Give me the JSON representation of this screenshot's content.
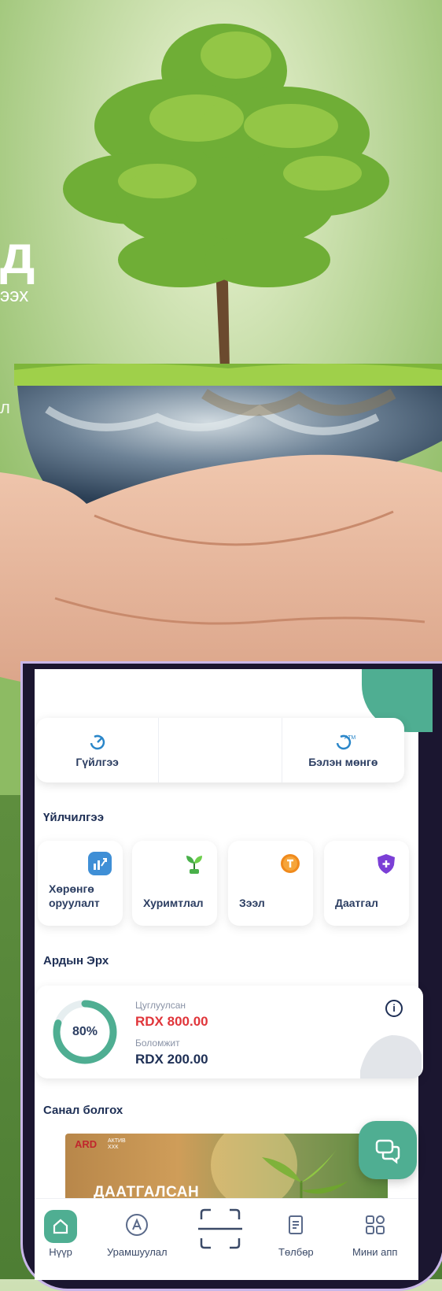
{
  "hero": {
    "title_fragment": "д",
    "subtitle_fragment": "ээх",
    "side_fragment": "л"
  },
  "quick_actions": [
    {
      "label": "Гүйлгээ",
      "icon": "transfer-icon"
    },
    {
      "label": "",
      "icon": ""
    },
    {
      "label": "Бэлэн мөнгө",
      "icon": "atm-icon",
      "icon_text": "ATM"
    }
  ],
  "services": {
    "title": "Үйлчилгээ",
    "items": [
      {
        "label": "Хөрөнгө оруулалт",
        "icon": "investment-chart-icon",
        "color": "#3f8fd6"
      },
      {
        "label": "Хуримтлал",
        "icon": "plant-savings-icon",
        "color": "#49b04a"
      },
      {
        "label": "Зээл",
        "icon": "loan-coin-icon",
        "color": "#f08a1c"
      },
      {
        "label": "Даатгал",
        "icon": "shield-plus-icon",
        "color": "#7b3fd6"
      }
    ]
  },
  "ardyn_erkh": {
    "title": "Ардын Эрх",
    "percent_label": "80%",
    "progress": 0.8,
    "collected_label": "Цуглуулсан",
    "collected_value": "RDX 800.00",
    "available_label": "Боломжит",
    "available_value": "RDX 200.00",
    "accent": "#4fae92",
    "collected_color": "#e0353a"
  },
  "offers": {
    "title": "Санал болгох",
    "banner_logo": "ARD",
    "banner_sub": "АКТИВ\nХХК",
    "banner_text": "ДААТГАЛСАН"
  },
  "bottom_nav": [
    {
      "label": "Нүүр",
      "icon": "home-icon"
    },
    {
      "label": "Урамшуулал",
      "icon": "reward-icon"
    },
    {
      "label": "",
      "icon": "scan-icon"
    },
    {
      "label": "Төлбөр",
      "icon": "receipt-icon"
    },
    {
      "label": "Мини апп",
      "icon": "apps-grid-icon"
    }
  ]
}
